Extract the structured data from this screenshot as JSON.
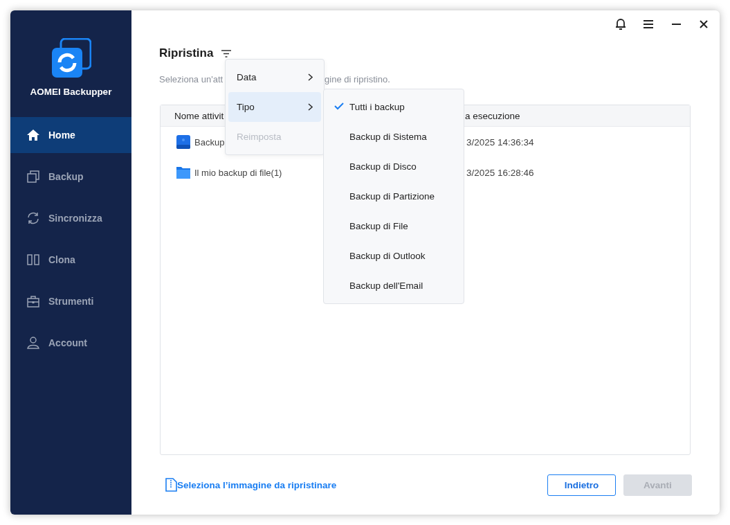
{
  "sidebar": {
    "brand": "AOMEI Backupper",
    "items": [
      {
        "label": "Home",
        "selected": true
      },
      {
        "label": "Backup",
        "selected": false
      },
      {
        "label": "Sincronizza",
        "selected": false
      },
      {
        "label": "Clona",
        "selected": false
      },
      {
        "label": "Strumenti",
        "selected": false
      },
      {
        "label": "Account",
        "selected": false
      }
    ]
  },
  "page": {
    "title": "Ripristina",
    "subtitle_fragments": [
      "Seleziona un'att",
      "gine di ripristino."
    ],
    "table": {
      "columns": [
        "Nome attivit",
        "a esecuzione"
      ],
      "rows": [
        {
          "kind": "disk",
          "name": "Backup",
          "column_2": "3/2025 14:36:34"
        },
        {
          "kind": "folder",
          "name": "Il mio backup di file(1)",
          "column_2": "3/2025 16:28:46"
        }
      ]
    },
    "filter_menu": [
      {
        "label": "Data",
        "submenu": true,
        "highlighted": false,
        "disabled": false
      },
      {
        "label": "Tipo",
        "submenu": true,
        "highlighted": true,
        "disabled": false
      },
      {
        "label": "Reimposta",
        "submenu": false,
        "highlighted": false,
        "disabled": true
      }
    ],
    "type_submenu": [
      {
        "label": "Tutti i backup",
        "checked": true
      },
      {
        "label": "Backup di Sistema",
        "checked": false
      },
      {
        "label": "Backup di Disco",
        "checked": false
      },
      {
        "label": "Backup di Partizione",
        "checked": false
      },
      {
        "label": "Backup di File",
        "checked": false
      },
      {
        "label": "Backup di Outlook",
        "checked": false
      },
      {
        "label": "Backup dell'Email",
        "checked": false
      }
    ],
    "link": "Seleziona l’immagine da ripristinare",
    "buttons": [
      {
        "label": "Indietro",
        "disabled": false
      },
      {
        "label": "Avanti",
        "disabled": true
      }
    ]
  }
}
